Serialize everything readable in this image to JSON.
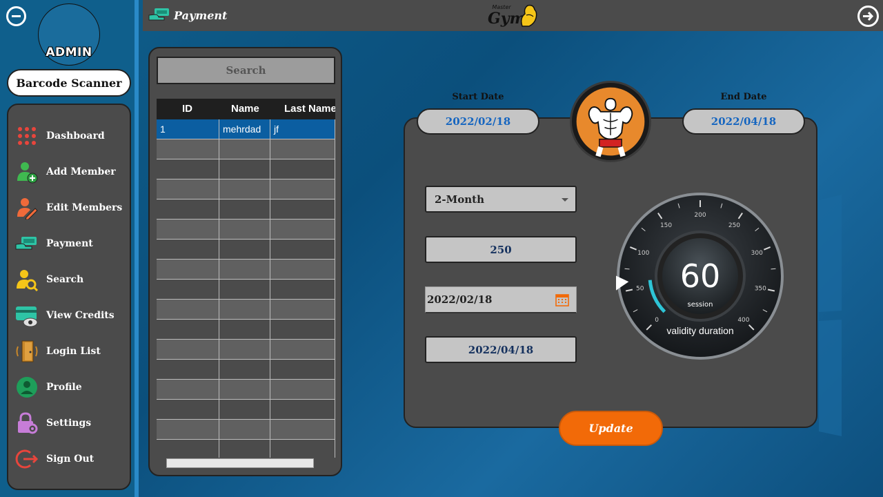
{
  "sidebar": {
    "admin_label": "ADMIN",
    "barcode_button": "Barcode Scanner",
    "items": [
      {
        "label": "Dashboard",
        "icon": "dots-grid-icon"
      },
      {
        "label": "Add Member",
        "icon": "add-user-icon"
      },
      {
        "label": "Edit Members",
        "icon": "edit-user-icon"
      },
      {
        "label": "Payment",
        "icon": "payment-hand-icon"
      },
      {
        "label": "Search",
        "icon": "search-user-icon"
      },
      {
        "label": "View Credits",
        "icon": "card-view-icon"
      },
      {
        "label": "Login List",
        "icon": "door-icon"
      },
      {
        "label": "Profile",
        "icon": "profile-icon"
      },
      {
        "label": "Settings",
        "icon": "lock-gear-icon"
      },
      {
        "label": "Sign Out",
        "icon": "sign-out-icon"
      }
    ]
  },
  "topbar": {
    "title": "Payment",
    "logo_master": "Master",
    "logo_gym": "Gym"
  },
  "table": {
    "search_placeholder": "Search",
    "columns": [
      "ID",
      "Name",
      "Last Name"
    ],
    "rows": [
      {
        "id": "1",
        "name": "mehrdad",
        "last_name": "jf"
      }
    ]
  },
  "payment": {
    "start_date_label": "Start Date",
    "end_date_label": "End Date",
    "start_date": "2022/02/18",
    "end_date": "2022/04/18",
    "plan": "2-Month",
    "amount": "250",
    "date_picker_value": "2022/02/18",
    "end_date_field": "2022/04/18",
    "update_button": "Update"
  },
  "gauge": {
    "value": "60",
    "unit": "session",
    "caption": "validity duration",
    "ticks": [
      "0",
      "50",
      "100",
      "150",
      "200",
      "250",
      "300",
      "350",
      "400"
    ]
  },
  "colors": {
    "accent": "#f26a08",
    "selected_row": "#0b5ea1",
    "date_text": "#1565c0",
    "gauge_arc": "#2ec4d6"
  }
}
